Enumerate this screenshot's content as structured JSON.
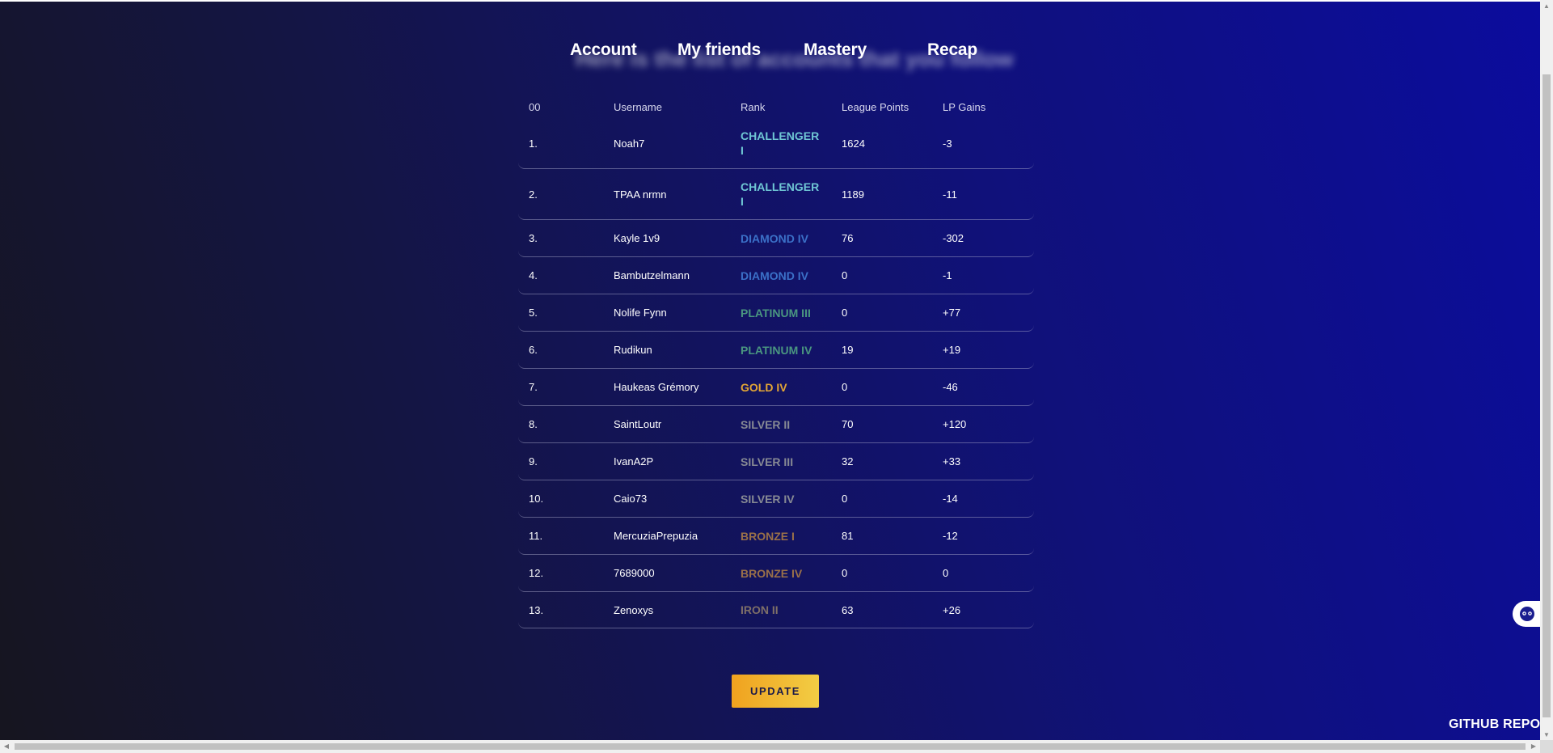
{
  "nav": {
    "items": [
      "Account",
      "My friends",
      "Mastery",
      "Recap"
    ]
  },
  "ghost_heading": "Here is the list of accounts that you follow",
  "table": {
    "headers": [
      "00",
      "Username",
      "Rank",
      "League Points",
      "LP Gains"
    ],
    "rows": [
      {
        "pos": "1.",
        "username": "Noah7",
        "rank": "CHALLENGER I",
        "rank_color": "#6fc6d4",
        "lp": "1624",
        "gain": "-3"
      },
      {
        "pos": "2.",
        "username": "TPAA nrmn",
        "rank": "CHALLENGER I",
        "rank_color": "#6fc6d4",
        "lp": "1189",
        "gain": "-11"
      },
      {
        "pos": "3.",
        "username": "Kayle 1v9",
        "rank": "DIAMOND IV",
        "rank_color": "#3b70c8",
        "lp": "76",
        "gain": "-302"
      },
      {
        "pos": "4.",
        "username": "Bambutzelmann",
        "rank": "DIAMOND IV",
        "rank_color": "#3b70c8",
        "lp": "0",
        "gain": "-1"
      },
      {
        "pos": "5.",
        "username": "Nolife Fynn",
        "rank": "PLATINUM III",
        "rank_color": "#4a9680",
        "lp": "0",
        "gain": "+77"
      },
      {
        "pos": "6.",
        "username": "Rudikun",
        "rank": "PLATINUM IV",
        "rank_color": "#4a9680",
        "lp": "19",
        "gain": "+19"
      },
      {
        "pos": "7.",
        "username": "Haukeas Grémory",
        "rank": "GOLD IV",
        "rank_color": "#e3a635",
        "lp": "0",
        "gain": "-46"
      },
      {
        "pos": "8.",
        "username": "SaintLoutr",
        "rank": "SILVER II",
        "rank_color": "#878a94",
        "lp": "70",
        "gain": "+120"
      },
      {
        "pos": "9.",
        "username": "IvanA2P",
        "rank": "SILVER III",
        "rank_color": "#878a94",
        "lp": "32",
        "gain": "+33"
      },
      {
        "pos": "10.",
        "username": "Caio73",
        "rank": "SILVER IV",
        "rank_color": "#878a94",
        "lp": "0",
        "gain": "-14"
      },
      {
        "pos": "11.",
        "username": "MercuziaPrepuzia",
        "rank": "BRONZE I",
        "rank_color": "#9a7049",
        "lp": "81",
        "gain": "-12"
      },
      {
        "pos": "12.",
        "username": "7689000",
        "rank": "BRONZE IV",
        "rank_color": "#9a7049",
        "lp": "0",
        "gain": "0"
      },
      {
        "pos": "13.",
        "username": "Zenoxys",
        "rank": "IRON II",
        "rank_color": "#7e6f68",
        "lp": "63",
        "gain": "+26"
      }
    ]
  },
  "update_label": "UPDATE",
  "github_label": "GITHUB REPO",
  "chat_icon": "chat-bot-icon"
}
